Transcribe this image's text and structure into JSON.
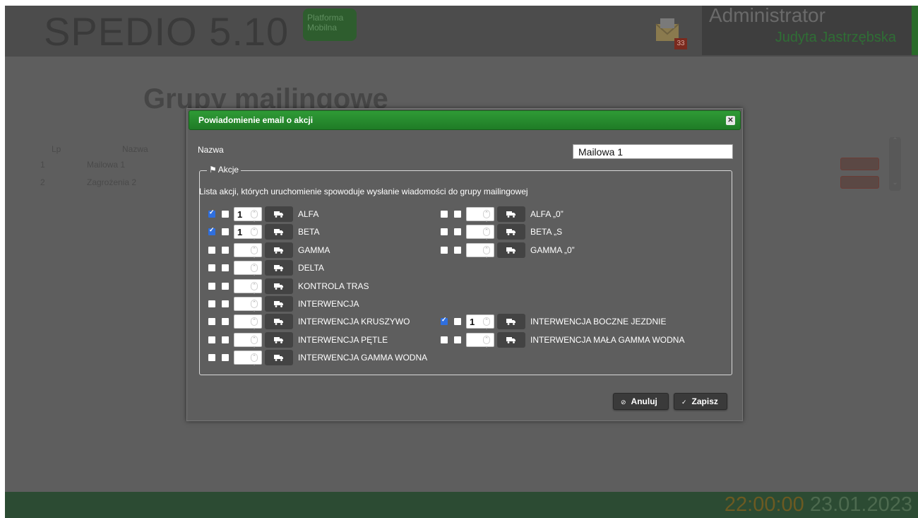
{
  "header": {
    "brand": "SPEDIO 5.10",
    "platform_line1": "Platforma",
    "platform_line2": "Mobilna",
    "mail_count": "33",
    "role": "Administrator",
    "user": "Judyta Jastrzębska"
  },
  "page": {
    "title": "Grupy mailingowe",
    "columns": [
      "Lp",
      "Nazwa"
    ],
    "rows": [
      {
        "lp": "1",
        "name": "Mailowa 1"
      },
      {
        "lp": "2",
        "name": "Zagrożenia 2"
      }
    ]
  },
  "footer": {
    "time": "22:00:00",
    "date": "23.01.2023"
  },
  "dialog": {
    "title": "Powiadomienie email o akcji",
    "name_label": "Nazwa",
    "name_value": "Mailowa 1",
    "legend": "Akcje",
    "intro": "Lista akcji, których uruchomienie spowoduje wysłanie wiadomości do grupy mailingowej",
    "cancel_label": "Anuluj",
    "save_label": "Zapisz",
    "actions_left": [
      {
        "label": "ALFA",
        "checked": true,
        "value": "1"
      },
      {
        "label": "BETA",
        "checked": true,
        "value": "1"
      },
      {
        "label": "GAMMA",
        "checked": false,
        "value": ""
      },
      {
        "label": "DELTA",
        "checked": false,
        "value": ""
      },
      {
        "label": "KONTROLA TRAS",
        "checked": false,
        "value": ""
      },
      {
        "label": "INTERWENCJA",
        "checked": false,
        "value": ""
      },
      {
        "label": "INTERWENCJA KRUSZYWO",
        "checked": false,
        "value": ""
      },
      {
        "label": "INTERWENCJA PĘTLE",
        "checked": false,
        "value": ""
      },
      {
        "label": "INTERWENCJA GAMMA WODNA",
        "checked": false,
        "value": ""
      }
    ],
    "actions_right": [
      {
        "label": "ALFA „0”",
        "checked": false,
        "value": "",
        "row": 0
      },
      {
        "label": "BETA „S",
        "checked": false,
        "value": "",
        "row": 1
      },
      {
        "label": "GAMMA „0”",
        "checked": false,
        "value": "",
        "row": 2
      },
      {
        "label": "INTERWENCJA BOCZNE JEZDNIE",
        "checked": true,
        "value": "1",
        "row": 6
      },
      {
        "label": "INTERWENCJA MAŁA GAMMA WODNA",
        "checked": false,
        "value": "",
        "row": 7
      }
    ]
  }
}
